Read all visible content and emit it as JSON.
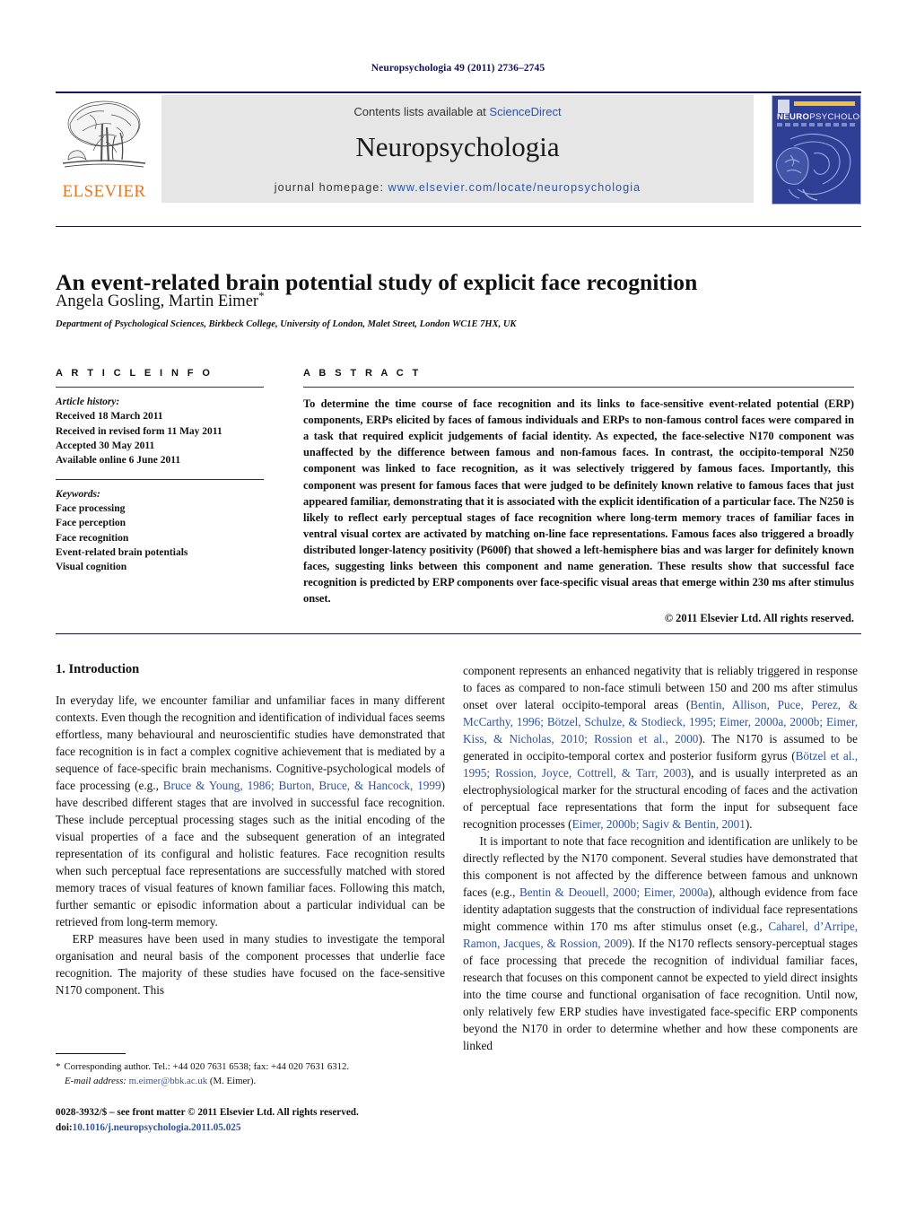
{
  "running_head": "Neuropsychologia 49 (2011) 2736–2745",
  "masthead": {
    "contents_prefix": "Contents lists available at ",
    "sciencedirect": "ScienceDirect",
    "journal_title": "Neuropsychologia",
    "homepage_prefix": "journal homepage: ",
    "homepage_url": "www.elsevier.com/locate/neuropsychologia",
    "publisher_name": "ELSEVIER",
    "publisher_accent": "#e87722",
    "cover_title_a": "NEURO",
    "cover_title_b": "PSYCHOLOGIA",
    "cover_bg": "#2f3f96",
    "link_color": "#2b53a8"
  },
  "article": {
    "title": "An event-related brain potential study of explicit face recognition",
    "authors": "Angela Gosling, Martin Eimer",
    "corresponding_marker": "*",
    "affiliation": "Department of Psychological Sciences, Birkbeck College, University of London, Malet Street, London WC1E 7HX, UK"
  },
  "info": {
    "heading": "A R T I C L E    I N F O",
    "history_label": "Article history:",
    "history": [
      "Received 18 March 2011",
      "Received in revised form 11 May 2011",
      "Accepted 30 May 2011",
      "Available online 6 June 2011"
    ],
    "keywords_label": "Keywords:",
    "keywords": [
      "Face processing",
      "Face perception",
      "Face recognition",
      "Event-related brain potentials",
      "Visual cognition"
    ]
  },
  "abstract": {
    "heading": "A B S T R A C T",
    "text": "To determine the time course of face recognition and its links to face-sensitive event-related potential (ERP) components, ERPs elicited by faces of famous individuals and ERPs to non-famous control faces were compared in a task that required explicit judgements of facial identity. As expected, the face-selective N170 component was unaffected by the difference between famous and non-famous faces. In contrast, the occipito-temporal N250 component was linked to face recognition, as it was selectively triggered by famous faces. Importantly, this component was present for famous faces that were judged to be definitely known relative to famous faces that just appeared familiar, demonstrating that it is associated with the explicit identification of a particular face. The N250 is likely to reflect early perceptual stages of face recognition where long-term memory traces of familiar faces in ventral visual cortex are activated by matching on-line face representations. Famous faces also triggered a broadly distributed longer-latency positivity (P600f) that showed a left-hemisphere bias and was larger for definitely known faces, suggesting links between this component and name generation. These results show that successful face recognition is predicted by ERP components over face-specific visual areas that emerge within 230 ms after stimulus onset.",
    "copyright": "© 2011 Elsevier Ltd. All rights reserved."
  },
  "body": {
    "section_number_title": "1.  Introduction",
    "left_paragraph_1_a": "In everyday life, we encounter familiar and unfamiliar faces in many different contexts. Even though the recognition and identification of individual faces seems effortless, many behavioural and neuroscientific studies have demonstrated that face recognition is in fact a complex cognitive achievement that is mediated by a sequence of face-specific brain mechanisms. Cognitive-psychological models of face processing (e.g., ",
    "left_cite_1": "Bruce & Young, 1986; Burton, Bruce, & Hancock, 1999",
    "left_paragraph_1_b": ") have described different stages that are involved in successful face recognition. These include perceptual processing stages such as the initial encoding of the visual properties of a face and the subsequent generation of an integrated representation of its configural and holistic features. Face recognition results when such perceptual face representations are successfully matched with stored memory traces of visual features of known familiar faces. Following this match, further semantic or episodic information about a particular individual can be retrieved from long-term memory.",
    "left_paragraph_2": "ERP measures have been used in many studies to investigate the temporal organisation and neural basis of the component processes that underlie face recognition. The majority of these studies have focused on the face-sensitive N170 component. This",
    "right_paragraph_1_a": "component represents an enhanced negativity that is reliably triggered in response to faces as compared to non-face stimuli between 150 and 200 ms after stimulus onset over lateral occipito-temporal areas (",
    "right_cite_1": "Bentin, Allison, Puce, Perez, & McCarthy, 1996; Bötzel, Schulze, & Stodieck, 1995; Eimer, 2000a, 2000b; Eimer, Kiss, & Nicholas, 2010; Rossion et al., 2000",
    "right_paragraph_1_b": "). The N170 is assumed to be generated in occipito-temporal cortex and posterior fusiform gyrus (",
    "right_cite_2": "Bötzel et al., 1995; Rossion, Joyce, Cottrell, & Tarr, 2003",
    "right_paragraph_1_c": "), and is usually interpreted as an electrophysiological marker for the structural encoding of faces and the activation of perceptual face representations that form the input for subsequent face recognition processes (",
    "right_cite_3": "Eimer, 2000b; Sagiv & Bentin, 2001",
    "right_paragraph_1_d": ").",
    "right_paragraph_2_a": "It is important to note that face recognition and identification are unlikely to be directly reflected by the N170 component. Several studies have demonstrated that this component is not affected by the difference between famous and unknown faces (e.g., ",
    "right_cite_4": "Bentin & Deouell, 2000; Eimer, 2000a",
    "right_paragraph_2_b": "), although evidence from face identity adaptation suggests that the construction of individual face representations might commence within 170 ms after stimulus onset (e.g., ",
    "right_cite_5": "Caharel, d’Arripe, Ramon, Jacques, & Rossion, 2009",
    "right_paragraph_2_c": "). If the N170 reflects sensory-perceptual stages of face processing that precede the recognition of individual familiar faces, research that focuses on this component cannot be expected to yield direct insights into the time course and functional organisation of face recognition. Until now, only relatively few ERP studies have investigated face-specific ERP components beyond the N170 in order to determine whether and how these components are linked"
  },
  "footnotes": {
    "corresponding_star": "*",
    "corresponding_text": "Corresponding author. Tel.: +44 020 7631 6538; fax: +44 020 7631 6312.",
    "email_label": "E-mail address:",
    "email_address": "m.eimer@bbk.ac.uk",
    "email_owner": "(M. Eimer).",
    "issn_line": "0028-3932/$ – see front matter © 2011 Elsevier Ltd. All rights reserved.",
    "doi_label": "doi:",
    "doi_value": "10.1016/j.neuropsychologia.2011.05.025"
  }
}
